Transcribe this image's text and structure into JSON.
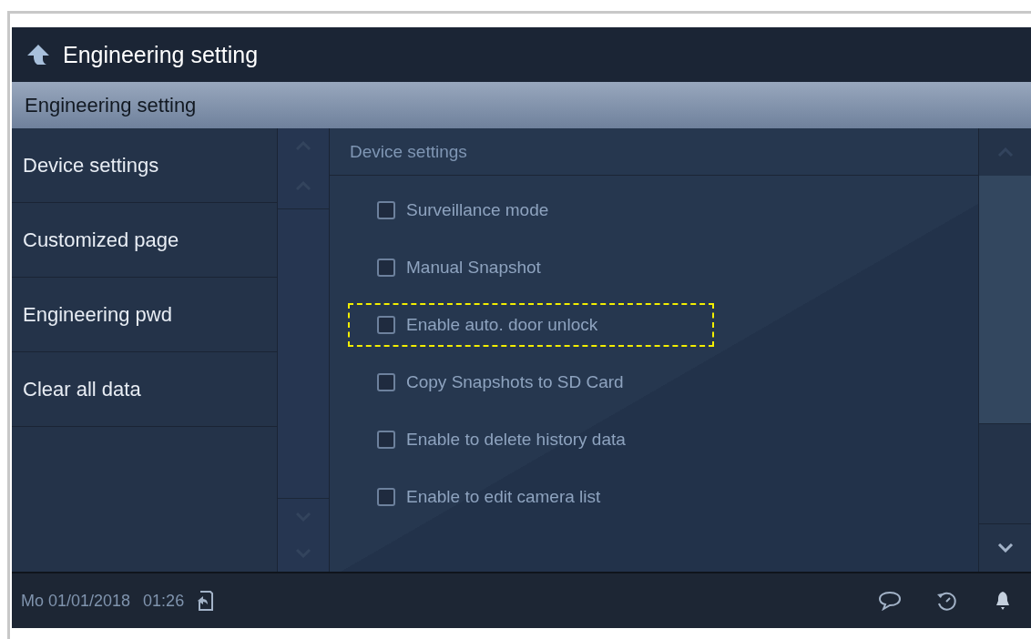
{
  "header": {
    "title": "Engineering setting"
  },
  "subheader": {
    "title": "Engineering setting"
  },
  "sidebar": {
    "items": [
      {
        "label": "Device settings"
      },
      {
        "label": "Customized page"
      },
      {
        "label": "Engineering pwd"
      },
      {
        "label": "Clear all data"
      }
    ]
  },
  "panel": {
    "title": "Device settings",
    "options": [
      {
        "label": "Surveillance mode",
        "checked": false,
        "highlighted": false
      },
      {
        "label": "Manual Snapshot",
        "checked": false,
        "highlighted": false
      },
      {
        "label": "Enable auto. door unlock",
        "checked": false,
        "highlighted": true
      },
      {
        "label": "Copy Snapshots to SD Card",
        "checked": false,
        "highlighted": false
      },
      {
        "label": "Enable to delete history data",
        "checked": false,
        "highlighted": false
      },
      {
        "label": "Enable to edit camera list",
        "checked": false,
        "highlighted": false
      }
    ]
  },
  "status_bar": {
    "date": "Mo 01/01/2018",
    "time": "01:26"
  }
}
